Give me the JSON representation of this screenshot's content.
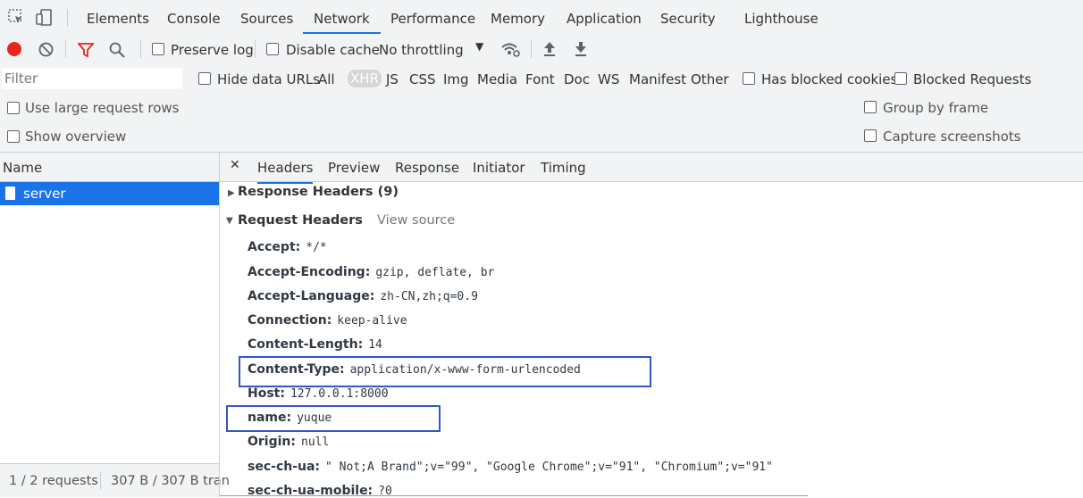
{
  "tabs": {
    "items": [
      "Elements",
      "Console",
      "Sources",
      "Network",
      "Performance",
      "Memory",
      "Application",
      "Security",
      "Lighthouse"
    ],
    "active": "Network"
  },
  "toolbar": {
    "preserve_log": "Preserve log",
    "disable_cache": "Disable cache",
    "throttling": "No throttling"
  },
  "filter": {
    "placeholder": "Filter",
    "hide_data_urls": "Hide data URLs",
    "types": [
      "All",
      "XHR",
      "JS",
      "CSS",
      "Img",
      "Media",
      "Font",
      "Doc",
      "WS",
      "Manifest",
      "Other"
    ],
    "active_type": "XHR",
    "has_blocked_cookies": "Has blocked cookies",
    "blocked_requests": "Blocked Requests"
  },
  "options": {
    "large_rows": "Use large request rows",
    "show_overview": "Show overview",
    "group_by_frame": "Group by frame",
    "capture_screenshots": "Capture screenshots"
  },
  "requests": {
    "header": "Name",
    "items": [
      "server"
    ],
    "status_count": "1 / 2 requests",
    "status_transfer": "307 B / 307 B tran"
  },
  "details": {
    "close_glyph": "✕",
    "tabs": [
      "Headers",
      "Preview",
      "Response",
      "Initiator",
      "Timing"
    ],
    "active_tab": "Headers",
    "response_headers_title": "Response Headers (9)",
    "request_headers_title": "Request Headers",
    "view_source": "View source",
    "request_headers": [
      {
        "key": "Accept:",
        "value": "*/*"
      },
      {
        "key": "Accept-Encoding:",
        "value": "gzip, deflate, br"
      },
      {
        "key": "Accept-Language:",
        "value": "zh-CN,zh;q=0.9"
      },
      {
        "key": "Connection:",
        "value": "keep-alive"
      },
      {
        "key": "Content-Length:",
        "value": "14"
      },
      {
        "key": "Content-Type:",
        "value": "application/x-www-form-urlencoded"
      },
      {
        "key": "Host:",
        "value": "127.0.0.1:8000"
      },
      {
        "key": "name:",
        "value": "yuque"
      },
      {
        "key": "Origin:",
        "value": "null"
      },
      {
        "key": "sec-ch-ua:",
        "value": "\" Not;A Brand\";v=\"99\", \"Google Chrome\";v=\"91\", \"Chromium\";v=\"91\""
      },
      {
        "key": "sec-ch-ua-mobile:",
        "value": "?0"
      }
    ]
  },
  "colors": {
    "accent": "#1a73e8",
    "record": "#e8271c",
    "filter_active": "#e8271c",
    "highlight_box": "#3456c8"
  }
}
